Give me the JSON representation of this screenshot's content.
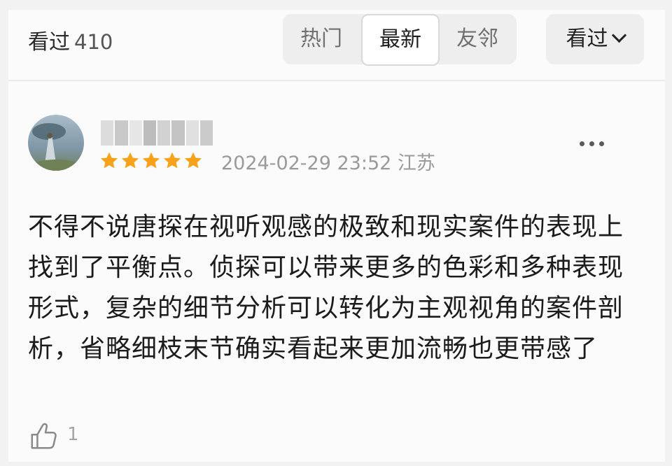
{
  "header": {
    "count_label": "看过",
    "count": "410",
    "tabs": [
      "热门",
      "最新",
      "友邻"
    ],
    "active_tab": "最新",
    "filter_label": "看过"
  },
  "review": {
    "username": "",
    "rating_stars": 5,
    "timestamp": "2024-02-29 23:52",
    "location": "江苏",
    "text": "不得不说唐探在视听观感的极致和现实案件的表现上找到了平衡点。侦探可以带来更多的色彩和多种表现形式，复杂的细节分析可以转化为主观视角的案件剖析，省略细枝末节确实看起来更加流畅也更带感了",
    "like_count": "1"
  },
  "colors": {
    "star": "#f7a21a",
    "active_tab_bg": "#ffffff",
    "segment_bg": "#eeeeee"
  },
  "icons": {
    "more": "ellipsis-icon",
    "like": "thumbs-up-icon",
    "dropdown": "chevron-down-icon"
  }
}
